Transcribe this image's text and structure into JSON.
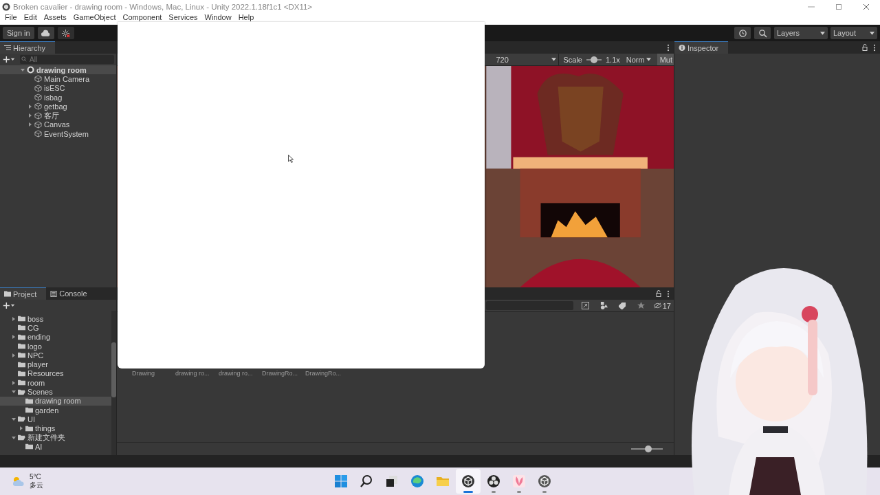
{
  "window": {
    "title": "Broken cavalier - drawing room - Windows, Mac, Linux - Unity 2022.1.18f1c1 <DX11>"
  },
  "menu": [
    "File",
    "Edit",
    "Assets",
    "GameObject",
    "Component",
    "Services",
    "Window",
    "Help"
  ],
  "toolbar": {
    "sign_in": "Sign in",
    "layers": "Layers",
    "layout": "Layout"
  },
  "hierarchy": {
    "tab": "Hierarchy",
    "search_placeholder": "All",
    "items": [
      {
        "label": "drawing room",
        "kind": "scene",
        "expanded": true,
        "children": [
          {
            "label": "Main Camera",
            "kind": "object"
          },
          {
            "label": "isESC",
            "kind": "object"
          },
          {
            "label": "isbag",
            "kind": "object"
          },
          {
            "label": "getbag",
            "kind": "object",
            "expanded": false
          },
          {
            "label": "客厅",
            "kind": "object",
            "expanded": false
          },
          {
            "label": "Canvas",
            "kind": "object",
            "expanded": false
          },
          {
            "label": "EventSystem",
            "kind": "object"
          }
        ]
      }
    ]
  },
  "game_view": {
    "resolution": "720",
    "scale_label": "Scale",
    "scale": "1.1x",
    "scale_slider": {
      "level": 0.5
    },
    "aspect": "Norm",
    "mute": "Mut",
    "scene": {
      "kind": "picture"
    }
  },
  "project": {
    "tabs": [
      {
        "label": "Project",
        "selected": true
      },
      {
        "label": "Console",
        "selected": false
      }
    ],
    "tree": [
      {
        "label": "boss",
        "expanded": false,
        "selected": false
      },
      {
        "label": "CG",
        "selected": false
      },
      {
        "label": "ending",
        "expanded": false,
        "selected": false
      },
      {
        "label": "logo",
        "selected": false
      },
      {
        "label": "NPC",
        "expanded": false,
        "selected": false
      },
      {
        "label": "player",
        "selected": false
      },
      {
        "label": "Resources",
        "selected": false
      },
      {
        "label": "room",
        "expanded": false,
        "selected": false
      },
      {
        "label": "Scenes",
        "expanded": true,
        "selected": false,
        "children": [
          {
            "label": "drawing room",
            "selected": true
          },
          {
            "label": "garden",
            "selected": false
          }
        ]
      },
      {
        "label": "UI",
        "expanded": true,
        "selected": false,
        "children": [
          {
            "label": "things",
            "expanded": false,
            "selected": false
          }
        ]
      },
      {
        "label": "新建文件夹",
        "expanded": true,
        "selected": false,
        "children": [
          {
            "label": "AI",
            "selected": false
          }
        ]
      }
    ],
    "hidden_count": "17",
    "assets": [
      "Drawing",
      "drawing ro...",
      "drawing ro...",
      "DrawingRo...",
      "DrawingRo..."
    ],
    "zoom_slider": {
      "level": 0.55
    }
  },
  "inspector": {
    "tab": "Inspector"
  },
  "taskbar": {
    "weather": {
      "temp": "5°C",
      "condition": "多云"
    },
    "apps": [
      {
        "kind": "start",
        "selected": false,
        "running": false
      },
      {
        "kind": "search",
        "selected": false,
        "running": false
      },
      {
        "kind": "taskview",
        "selected": false,
        "running": false
      },
      {
        "kind": "browser",
        "selected": false,
        "running": false
      },
      {
        "kind": "files",
        "selected": false,
        "running": false
      },
      {
        "kind": "unity",
        "selected": true,
        "running": true
      },
      {
        "kind": "recorder",
        "selected": false,
        "running": true
      },
      {
        "kind": "petal",
        "selected": false,
        "running": true
      },
      {
        "kind": "hub",
        "selected": false,
        "running": true
      }
    ]
  },
  "overlay": {
    "kind": "picture"
  }
}
